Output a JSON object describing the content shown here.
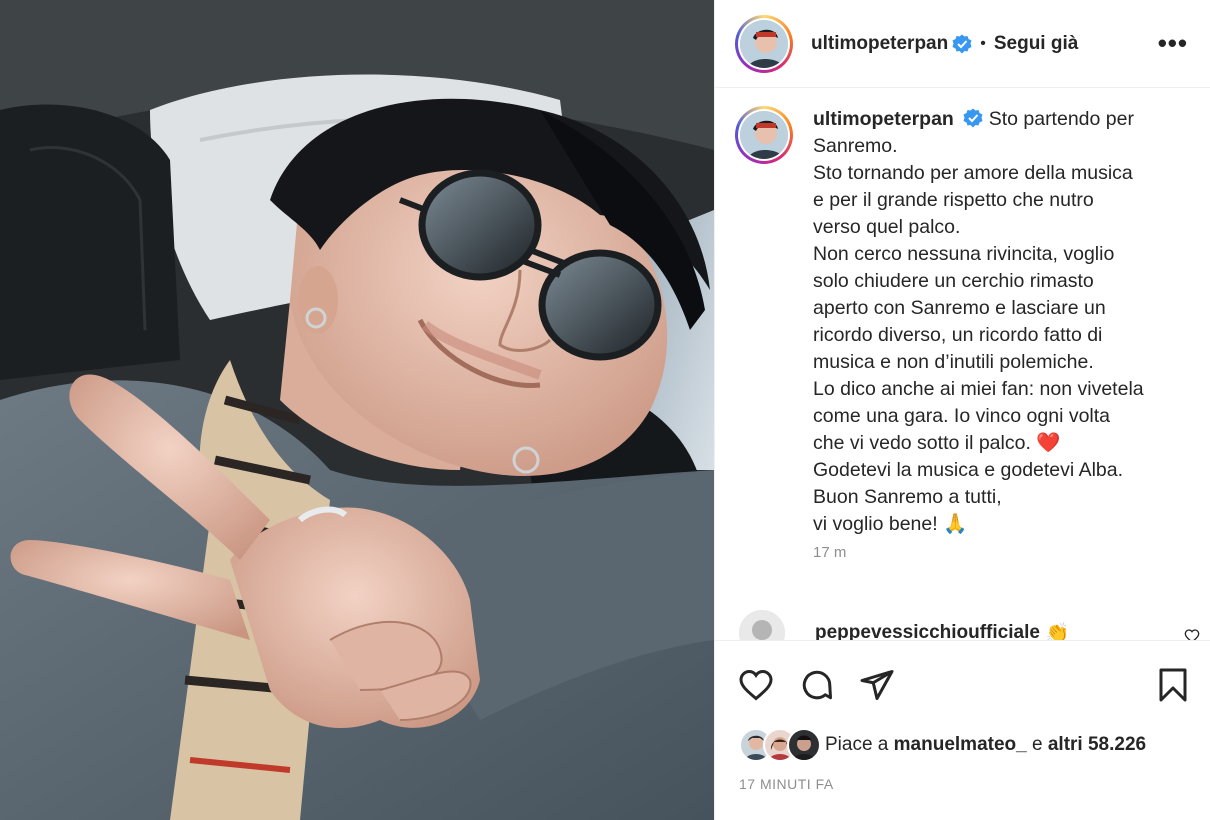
{
  "post": {
    "username": "ultimopeterpan",
    "follow_status": "Segui già",
    "more_label": "•••",
    "separator": "•"
  },
  "caption": {
    "username": "ultimopeterpan",
    "lines": [
      "Sto partendo per",
      "Sanremo.",
      "Sto tornando per amore della musica",
      "e per il grande rispetto che nutro",
      "verso quel palco.",
      "Non cerco nessuna rivincita, voglio",
      "solo chiudere un cerchio rimasto",
      "aperto con Sanremo e lasciare un",
      "ricordo diverso, un ricordo fatto di",
      "musica e non d’inutili polemiche.",
      "Lo dico anche ai miei fan: non vivetela",
      "come una gara. Io vinco ogni volta",
      "che vi vedo sotto il palco. ❤️",
      "Godetevi la musica e godetevi Alba.",
      "Buon Sanremo a tutti,",
      "vi voglio bene! 🙏"
    ],
    "time_ago": "17 m"
  },
  "next_comment": {
    "username": "peppevessicchioufficiale",
    "emoji": "👏"
  },
  "actions": {
    "like_icon": "heart-icon",
    "comment_icon": "comment-icon",
    "share_icon": "share-icon",
    "save_icon": "bookmark-icon"
  },
  "likes": {
    "prefix": "Piace a",
    "user": "manuelmateo_",
    "connector": "e",
    "others": "altri 58.226"
  },
  "timestamp": "17 MINUTI FA",
  "colors": {
    "verified": "#3897f0",
    "heart": "#ed4956",
    "text": "#262626",
    "secondary": "#8e8e8e"
  }
}
